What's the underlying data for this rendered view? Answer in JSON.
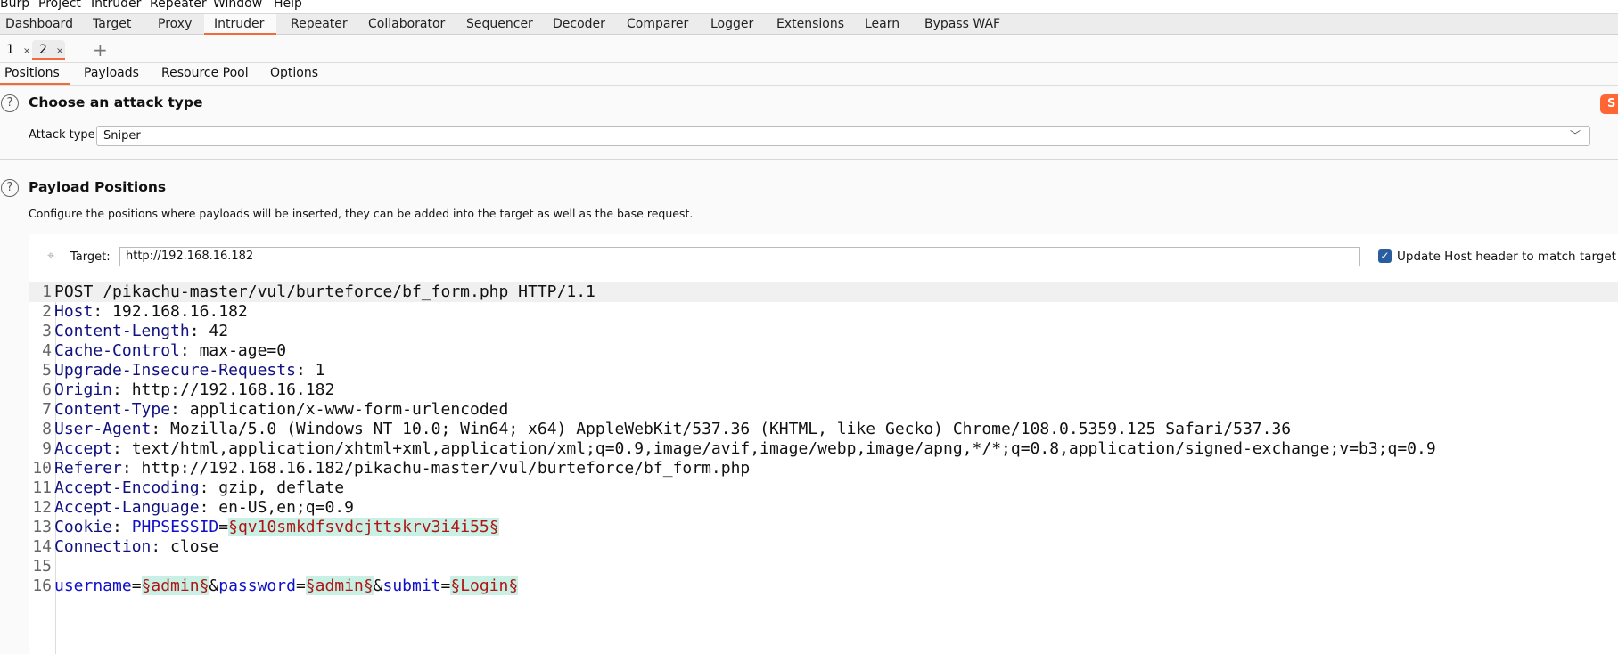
{
  "menu": [
    "Burp",
    "Project",
    "Intruder",
    "Repeater",
    "Window",
    "Help"
  ],
  "main_tabs": [
    "Dashboard",
    "Target",
    "Proxy",
    "Intruder",
    "Repeater",
    "Collaborator",
    "Sequencer",
    "Decoder",
    "Comparer",
    "Logger",
    "Extensions",
    "Learn",
    "Bypass WAF"
  ],
  "active_main_tab": "Intruder",
  "attack_tabs": [
    {
      "label": "1",
      "close": "×"
    },
    {
      "label": "2",
      "close": "×"
    }
  ],
  "new_tab": "+",
  "position_tabs": [
    "Positions",
    "Payloads",
    "Resource Pool",
    "Options"
  ],
  "attack_type": {
    "heading": "Choose an attack type",
    "label": "Attack type:",
    "value": "Sniper",
    "start_label": "S"
  },
  "payload_positions": {
    "heading": "Payload Positions",
    "description": "Configure the positions where payloads will be inserted, they can be added into the target as well as the base request.",
    "target_label": "Target:",
    "target_value": "http://192.168.16.182",
    "update_host_label": "Update Host header to match target",
    "update_host_checked": true
  },
  "colors": {
    "accent": "#ff6633",
    "payload_bg": "#c8f0e4",
    "payload_text": "#b01515",
    "header_key": "#101080",
    "param": "#1010c8"
  },
  "request_lines": [
    [
      {
        "t": "POST /pikachu-master/vul/burteforce/bf_form.php HTTP/1.1",
        "c": "val"
      }
    ],
    [
      {
        "t": "Host",
        "c": "key"
      },
      {
        "t": ": 192.168.16.182",
        "c": "val"
      }
    ],
    [
      {
        "t": "Content-Length",
        "c": "key"
      },
      {
        "t": ": 42",
        "c": "val"
      }
    ],
    [
      {
        "t": "Cache-Control",
        "c": "key"
      },
      {
        "t": ": max-age=0",
        "c": "val"
      }
    ],
    [
      {
        "t": "Upgrade-Insecure-Requests",
        "c": "key"
      },
      {
        "t": ": 1",
        "c": "val"
      }
    ],
    [
      {
        "t": "Origin",
        "c": "key"
      },
      {
        "t": ": http://192.168.16.182",
        "c": "val"
      }
    ],
    [
      {
        "t": "Content-Type",
        "c": "key"
      },
      {
        "t": ": application/x-www-form-urlencoded",
        "c": "val"
      }
    ],
    [
      {
        "t": "User-Agent",
        "c": "key"
      },
      {
        "t": ": Mozilla/5.0 (Windows NT 10.0; Win64; x64) AppleWebKit/537.36 (KHTML, like Gecko) Chrome/108.0.5359.125 Safari/537.36",
        "c": "val"
      }
    ],
    [
      {
        "t": "Accept",
        "c": "key"
      },
      {
        "t": ": text/html,application/xhtml+xml,application/xml;q=0.9,image/avif,image/webp,image/apng,*/*;q=0.8,application/signed-exchange;v=b3;q=0.9",
        "c": "val"
      }
    ],
    [
      {
        "t": "Referer",
        "c": "key"
      },
      {
        "t": ": http://192.168.16.182/pikachu-master/vul/burteforce/bf_form.php",
        "c": "val"
      }
    ],
    [
      {
        "t": "Accept-Encoding",
        "c": "key"
      },
      {
        "t": ": gzip, deflate",
        "c": "val"
      }
    ],
    [
      {
        "t": "Accept-Language",
        "c": "key"
      },
      {
        "t": ": en-US,en;q=0.9",
        "c": "val"
      }
    ],
    [
      {
        "t": "Cookie",
        "c": "key"
      },
      {
        "t": ": ",
        "c": "val"
      },
      {
        "t": "PHPSESSID",
        "c": "param"
      },
      {
        "t": "=",
        "c": "op"
      },
      {
        "t": "§qv10smkdfsvdcjttskrv3i4i55§",
        "c": "payload"
      }
    ],
    [
      {
        "t": "Connection",
        "c": "key"
      },
      {
        "t": ": close",
        "c": "val"
      }
    ],
    [],
    [
      {
        "t": "username",
        "c": "param"
      },
      {
        "t": "=",
        "c": "op"
      },
      {
        "t": "§admin§",
        "c": "payload"
      },
      {
        "t": "&",
        "c": "op"
      },
      {
        "t": "password",
        "c": "param"
      },
      {
        "t": "=",
        "c": "op"
      },
      {
        "t": "§admin§",
        "c": "payload"
      },
      {
        "t": "&",
        "c": "op"
      },
      {
        "t": "submit",
        "c": "param"
      },
      {
        "t": "=",
        "c": "op"
      },
      {
        "t": "§Login§",
        "c": "payload"
      }
    ]
  ]
}
